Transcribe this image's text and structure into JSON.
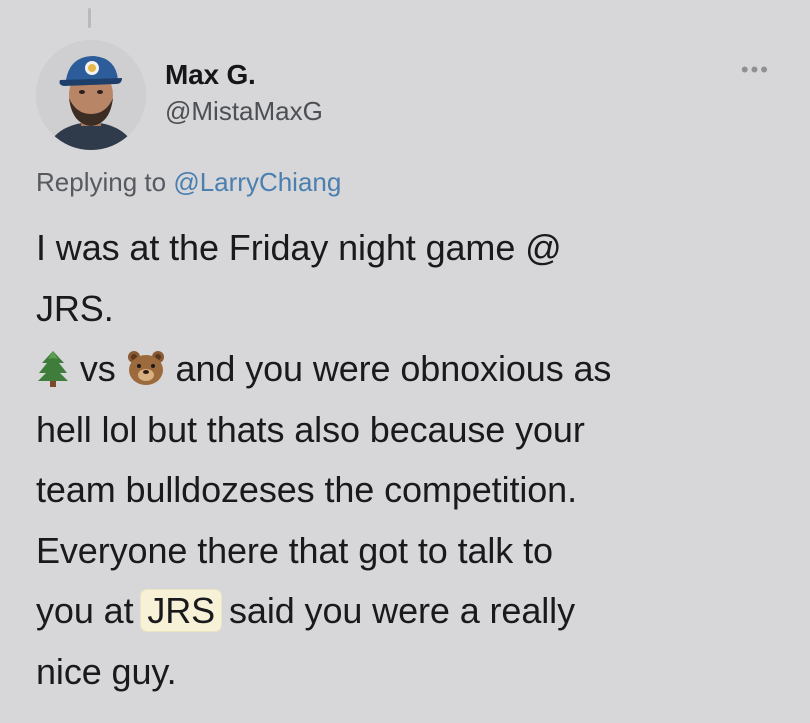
{
  "author": {
    "display_name": "Max G.",
    "handle": "@MistaMaxG"
  },
  "more_menu_icon": "more-horizontal-icon",
  "reply": {
    "prefix": "Replying to",
    "mention": "@LarryChiang"
  },
  "tweet": {
    "line1": "I was at the Friday night game @",
    "line2": "JRS.",
    "line3_vs": "vs",
    "line3_rest": "and you were obnoxious as",
    "line4": "hell lol but thats also because your",
    "line5": "team bulldozeses the competition.",
    "line6": "Everyone there that got to talk to",
    "line7_start": "you at",
    "line7_highlight": "JRS",
    "line7_end": "said you were a really",
    "line8": "nice guy.",
    "emoji_1": "evergreen-tree-emoji",
    "emoji_2": "bear-face-emoji"
  },
  "colors": {
    "background": "#d7d7d9",
    "mention": "#4a7fb0",
    "highlight": "#f6f1d7"
  }
}
